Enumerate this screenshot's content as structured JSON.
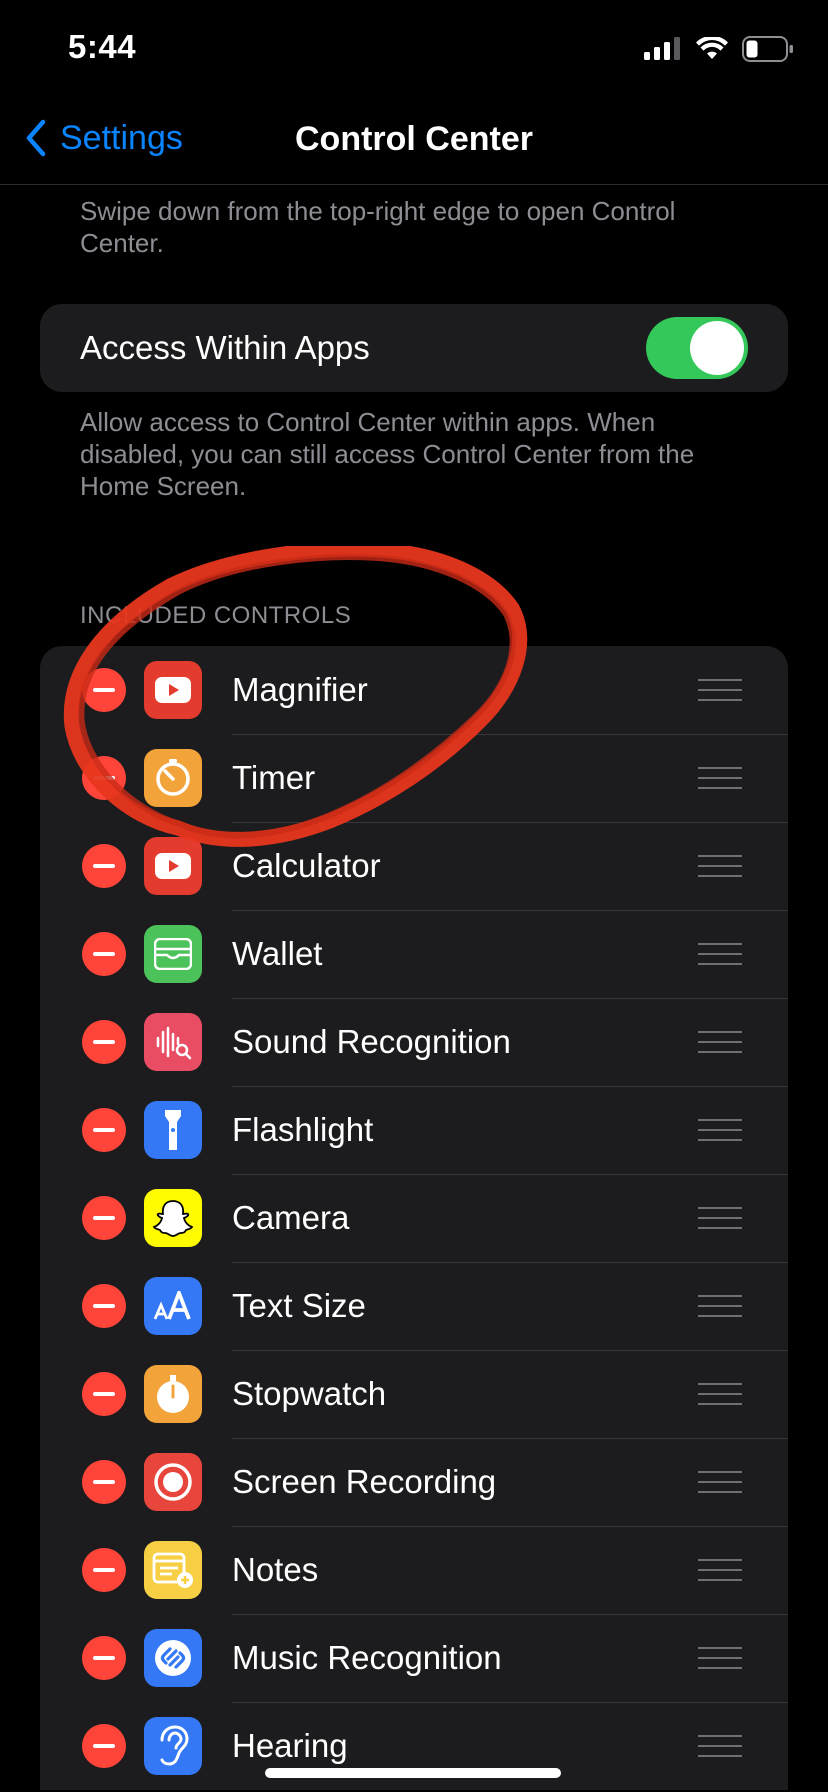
{
  "status": {
    "time": "5:44"
  },
  "nav": {
    "back_label": "Settings",
    "title": "Control Center"
  },
  "intro_text": "Swipe down from the top-right edge to open Control Center.",
  "access_within_apps": {
    "label": "Access Within Apps",
    "enabled": true,
    "footer": "Allow access to Control Center within apps. When disabled, you can still access Control Center from the Home Screen."
  },
  "included_controls": {
    "header": "INCLUDED CONTROLS",
    "items": [
      {
        "label": "Magnifier",
        "icon": "youtube-icon",
        "color": "#e33b2e"
      },
      {
        "label": "Timer",
        "icon": "timer-icon",
        "color": "#f2a33a"
      },
      {
        "label": "Calculator",
        "icon": "youtube-icon",
        "color": "#e33b2e"
      },
      {
        "label": "Wallet",
        "icon": "wallet-icon",
        "color": "#4cc35a"
      },
      {
        "label": "Sound Recognition",
        "icon": "sound-recognition-icon",
        "color": "#e84d64"
      },
      {
        "label": "Flashlight",
        "icon": "flashlight-icon",
        "color": "#3478f6"
      },
      {
        "label": "Camera",
        "icon": "snapchat-icon",
        "color": "#fffc00"
      },
      {
        "label": "Text Size",
        "icon": "text-size-icon",
        "color": "#3478f6"
      },
      {
        "label": "Stopwatch",
        "icon": "stopwatch-icon",
        "color": "#f2a33a"
      },
      {
        "label": "Screen Recording",
        "icon": "screen-recording-icon",
        "color": "#e8453c"
      },
      {
        "label": "Notes",
        "icon": "notes-icon",
        "color": "#f7cf45"
      },
      {
        "label": "Music Recognition",
        "icon": "shazam-icon",
        "color": "#3478f6"
      },
      {
        "label": "Hearing",
        "icon": "hearing-icon",
        "color": "#3478f6"
      }
    ]
  },
  "colors": {
    "accent": "#0a84ff",
    "toggle_on": "#34c759",
    "remove": "#ff453a",
    "annotation": "#e8361e"
  }
}
